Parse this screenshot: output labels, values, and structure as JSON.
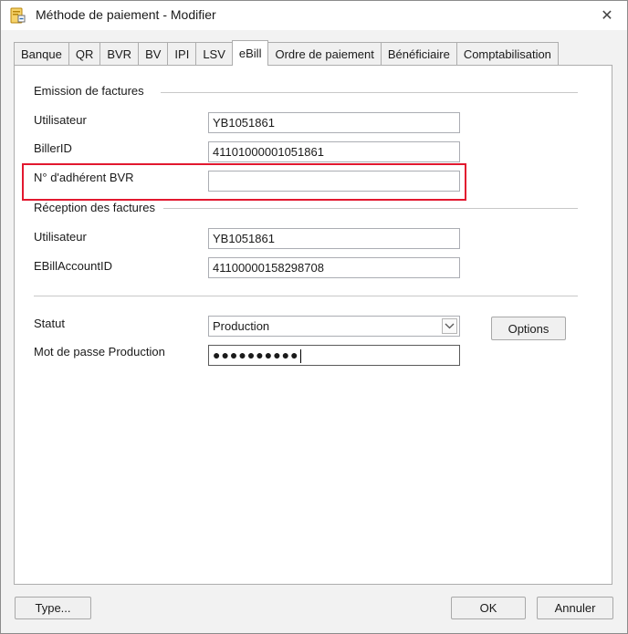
{
  "window": {
    "title": "Méthode de paiement - Modifier",
    "close_glyph": "✕"
  },
  "tabs": [
    {
      "label": "Banque"
    },
    {
      "label": "QR"
    },
    {
      "label": "BVR"
    },
    {
      "label": "BV"
    },
    {
      "label": "IPI"
    },
    {
      "label": "LSV"
    },
    {
      "label": "eBill",
      "active": true
    },
    {
      "label": "Ordre de paiement"
    },
    {
      "label": "Bénéficiaire"
    },
    {
      "label": "Comptabilisation"
    }
  ],
  "emission": {
    "group_label": "Emission de factures",
    "utilisateur_label": "Utilisateur",
    "utilisateur_value": "YB1051861",
    "billerid_label": "BillerID",
    "billerid_value": "41101000001051861",
    "adherent_label": "N° d'adhérent BVR",
    "adherent_value": ""
  },
  "reception": {
    "group_label": "Réception des factures",
    "utilisateur_label": "Utilisateur",
    "utilisateur_value": "YB1051861",
    "ebillaccount_label": "EBillAccountID",
    "ebillaccount_value": "41100000158298708"
  },
  "statut": {
    "label": "Statut",
    "value": "Production",
    "options_button": "Options",
    "password_label": "Mot de passe Production",
    "password_mask": "●●●●●●●●●●"
  },
  "footer": {
    "type_button": "Type...",
    "ok_button": "OK",
    "cancel_button": "Annuler"
  },
  "colors": {
    "highlight": "#e2182f",
    "accent": "#0078d7"
  },
  "icons": {
    "app": "payment-method-app-icon",
    "close": "close-icon",
    "dropdown": "chevron-down-icon"
  }
}
